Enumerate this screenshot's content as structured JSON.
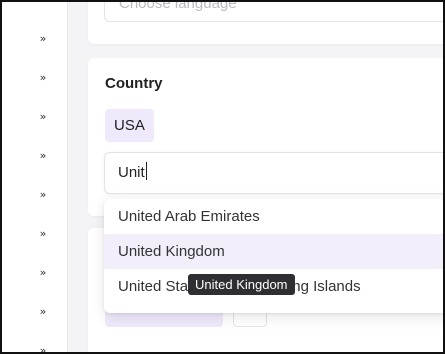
{
  "sidebar": {
    "expand_icon_glyph": "»",
    "buttons": [
      {
        "name": "expand-1"
      },
      {
        "name": "expand-2"
      },
      {
        "name": "expand-3"
      },
      {
        "name": "expand-4"
      },
      {
        "name": "expand-5"
      },
      {
        "name": "expand-6"
      },
      {
        "name": "expand-7"
      },
      {
        "name": "expand-8"
      },
      {
        "name": "expand-9"
      }
    ]
  },
  "language": {
    "placeholder": "Choose language"
  },
  "country": {
    "label": "Country",
    "selected_chip": "USA",
    "search_value": "Unit",
    "options": [
      "United Arab Emirates",
      "United Kingdom",
      "United States Minor Outlying Islands"
    ],
    "tooltip": "United Kingdom"
  },
  "colors": {
    "accent_chip": "#efe9fb",
    "option_hover": "#f2effb",
    "tooltip_bg": "#2f2f33"
  }
}
